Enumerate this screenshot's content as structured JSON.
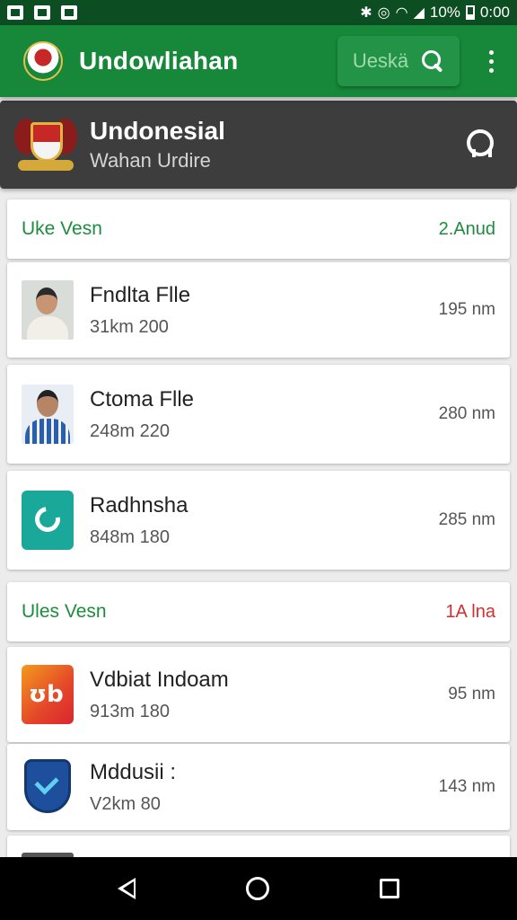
{
  "status_bar": {
    "battery": "10%",
    "time": "0:00"
  },
  "app_bar": {
    "title": "Undowliahan",
    "search_label": "Ueskä",
    "icons": [
      "crest-icon",
      "search-icon",
      "more-vert-icon"
    ]
  },
  "profile": {
    "name": "Undonesial",
    "subtitle": "Wahan Urdire",
    "icons": [
      "crest-emblem",
      "location-pin-icon"
    ]
  },
  "sections": [
    {
      "title": "Uke Vesn",
      "meta": "2.Anud",
      "meta_color": "#1e8c3e",
      "items": [
        {
          "title": "Fndlta Flle",
          "subtitle": "31km 200",
          "distance": "195 nm",
          "thumb": "person-photo"
        },
        {
          "title": "Ctoma Flle",
          "subtitle": "248m 220",
          "distance": "280 nm",
          "thumb": "person-photo"
        },
        {
          "title": "Radhnsha",
          "subtitle": "848m 180",
          "distance": "285 nm",
          "thumb": "teal-circle-app-icon"
        }
      ]
    },
    {
      "title": "Ules Vesn",
      "meta": "1A lna",
      "meta_color": "#d32f2f",
      "items": [
        {
          "title": "Vdbiat Indoam",
          "subtitle": "913m 180",
          "distance": "95 nm",
          "thumb": "orange-ub-app-icon"
        },
        {
          "title": "Mddusii :",
          "subtitle": "V2km 80",
          "distance": "143 nm",
          "thumb": "blue-shield-app-icon"
        }
      ]
    }
  ],
  "colors": {
    "primary": "#17883a",
    "status_bar": "#0d4d22",
    "profile_bg": "#3d3d3d"
  },
  "nav_bar": [
    "back-icon",
    "home-icon",
    "recents-icon"
  ]
}
